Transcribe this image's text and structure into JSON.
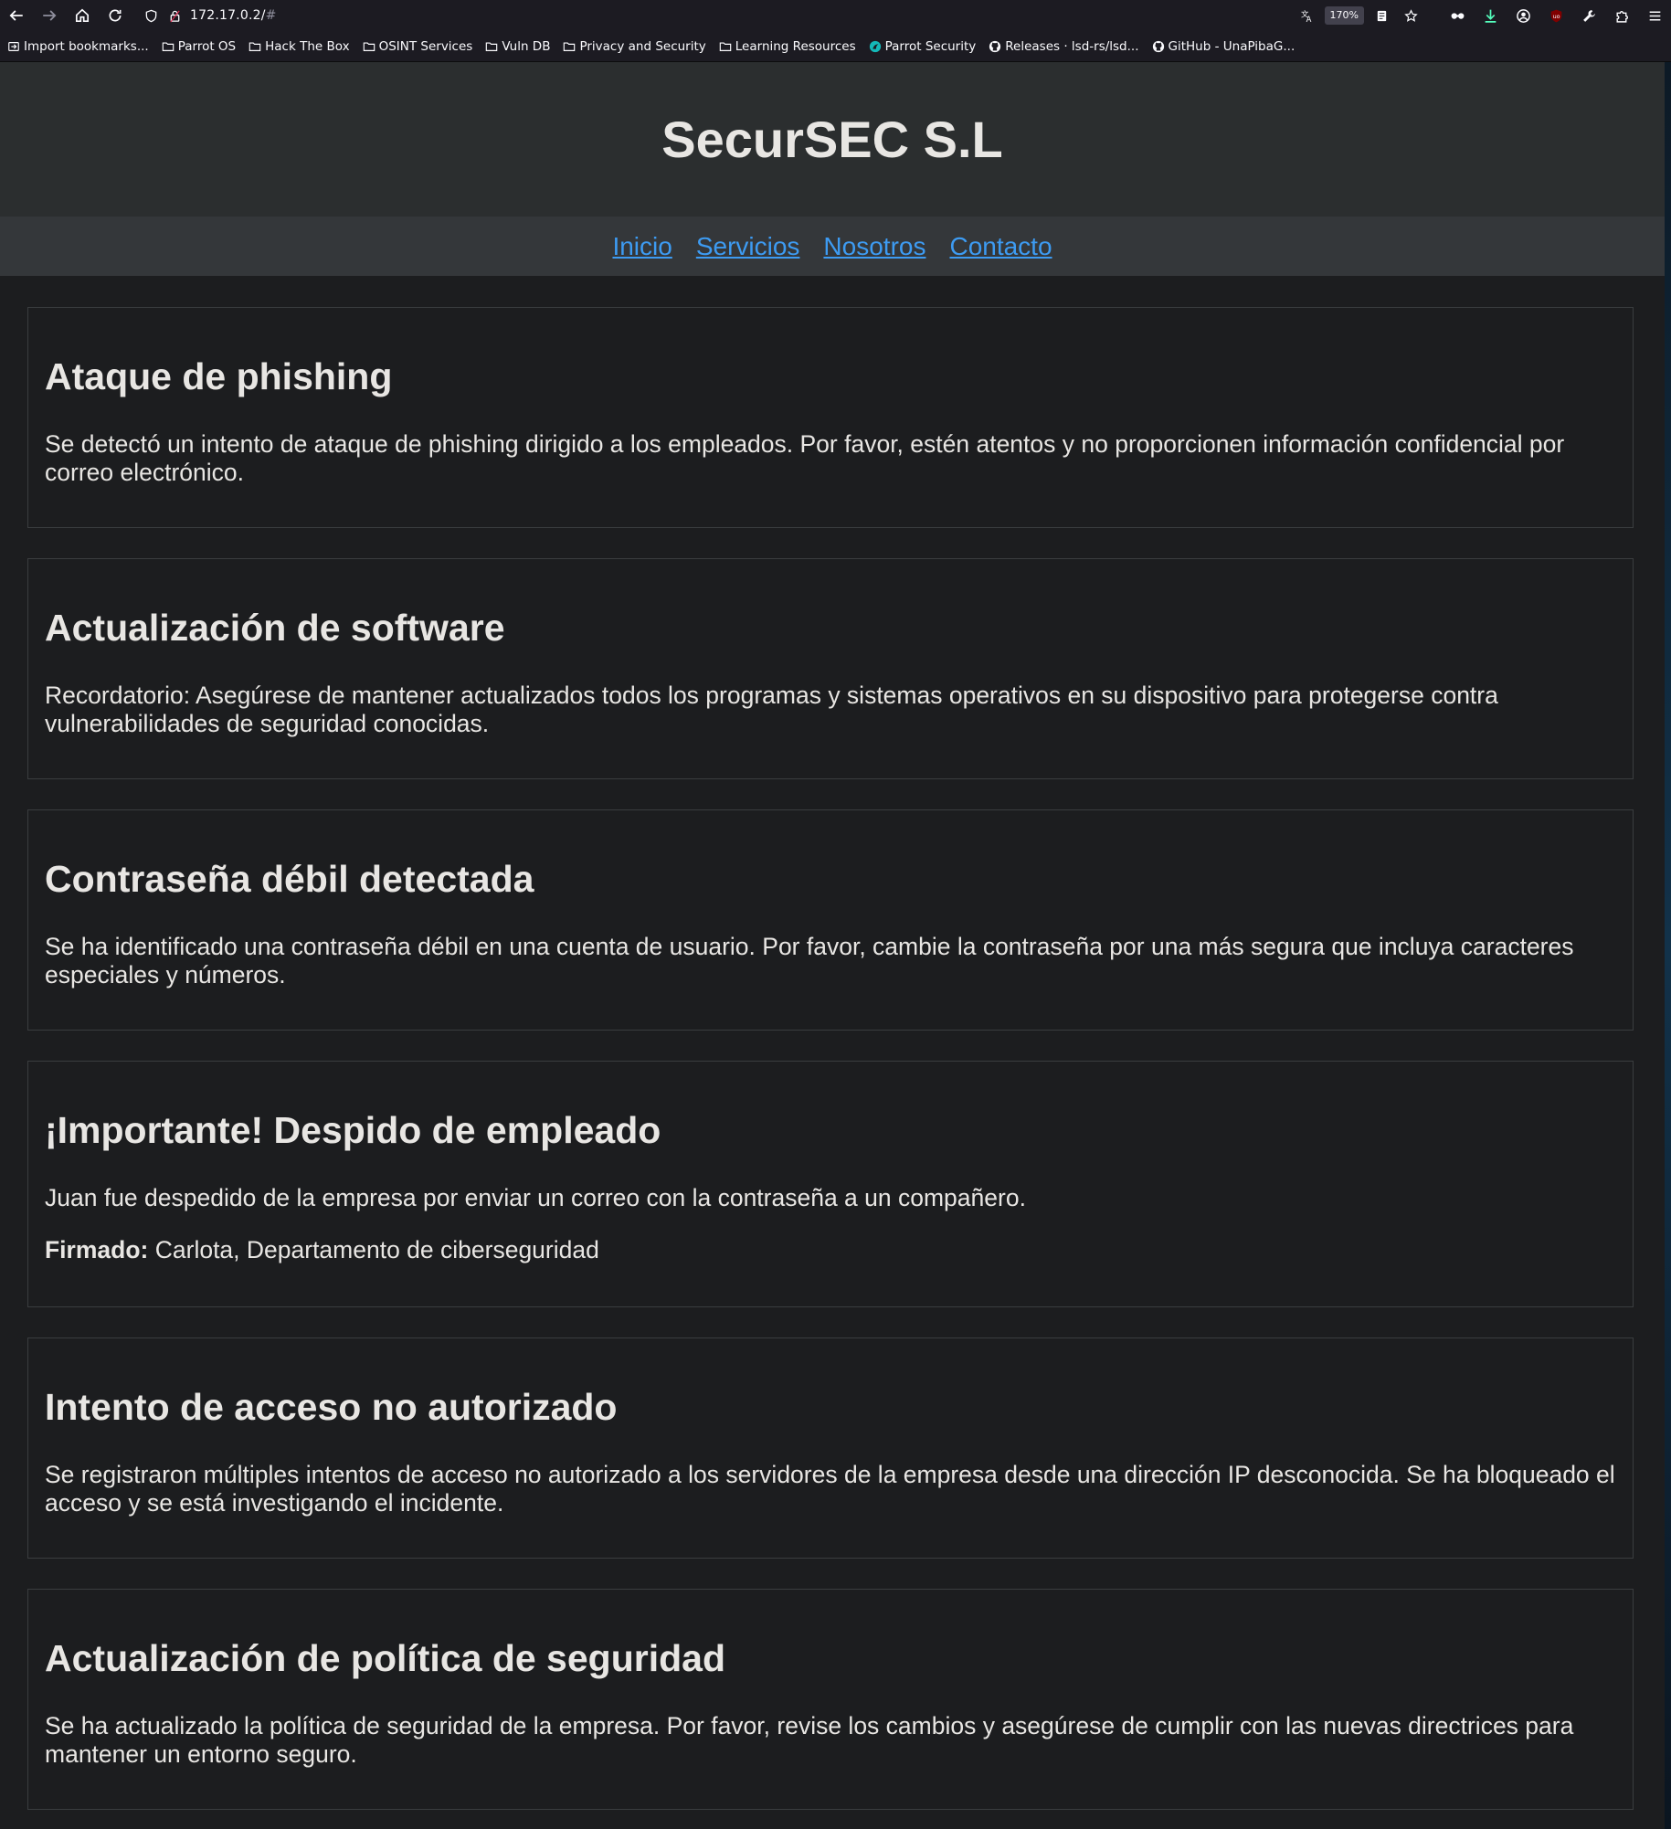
{
  "browser": {
    "url_host": "172.17.0.2/",
    "url_hash": "#",
    "zoom": "170%",
    "bookmarks": [
      {
        "label": "Import bookmarks...",
        "icon": "import-icon"
      },
      {
        "label": "Parrot OS",
        "icon": "folder-icon"
      },
      {
        "label": "Hack The Box",
        "icon": "folder-icon"
      },
      {
        "label": "OSINT Services",
        "icon": "folder-icon"
      },
      {
        "label": "Vuln DB",
        "icon": "folder-icon"
      },
      {
        "label": "Privacy and Security",
        "icon": "folder-icon"
      },
      {
        "label": "Learning Resources",
        "icon": "folder-icon"
      },
      {
        "label": "Parrot Security",
        "icon": "parrot-icon"
      },
      {
        "label": "Releases · lsd-rs/lsd...",
        "icon": "github-icon"
      },
      {
        "label": "GitHub - UnaPibaG...",
        "icon": "github-icon"
      }
    ]
  },
  "site": {
    "title": "SecurSEC S.L",
    "nav": [
      "Inicio",
      "Servicios",
      "Nosotros",
      "Contacto"
    ],
    "link_color": "#3d9bf2",
    "cards": [
      {
        "title": "Ataque de phishing",
        "body": "Se detectó un intento de ataque de phishing dirigido a los empleados. Por favor, estén atentos y no proporcionen información confidencial por correo electrónico."
      },
      {
        "title": "Actualización de software",
        "body": "Recordatorio: Asegúrese de mantener actualizados todos los programas y sistemas operativos en su dispositivo para protegerse contra vulnerabilidades de seguridad conocidas."
      },
      {
        "title": "Contraseña débil detectada",
        "body": "Se ha identificado una contraseña débil en una cuenta de usuario. Por favor, cambie la contraseña por una más segura que incluya caracteres especiales y números."
      },
      {
        "title": "¡Importante! Despido de empleado",
        "body": "Juan fue despedido de la empresa por enviar un correo con la contraseña a un compañero.",
        "signature_label": "Firmado:",
        "signature_text": " Carlota, Departamento de ciberseguridad"
      },
      {
        "title": "Intento de acceso no autorizado",
        "body": "Se registraron múltiples intentos de acceso no autorizado a los servidores de la empresa desde una dirección IP desconocida. Se ha bloqueado el acceso y se está investigando el incidente."
      },
      {
        "title": "Actualización de política de seguridad",
        "body": "Se ha actualizado la política de seguridad de la empresa. Por favor, revise los cambios y asegúrese de cumplir con las nuevas directrices para mantener un entorno seguro."
      }
    ]
  }
}
